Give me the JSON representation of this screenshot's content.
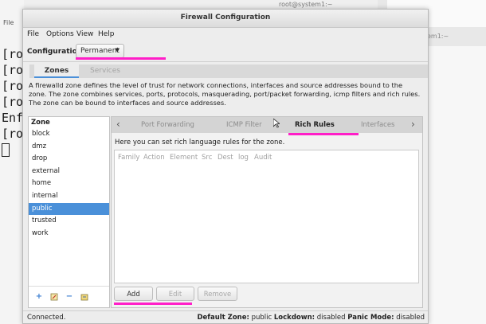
{
  "background": {
    "terminal_menu": "File",
    "terminal_lines": [
      "[ro",
      "[ro",
      "[ro",
      "[ro",
      "Enf",
      "[ro"
    ],
    "title_fragment": "root@system1:~",
    "right_tab_fragment": "em1:~"
  },
  "window": {
    "title": "Firewall Configuration",
    "menu": [
      "File",
      "Options",
      "View",
      "Help"
    ],
    "config_label": "Configuration:",
    "config_value": "Permanent",
    "main_tabs": [
      "Zones",
      "Services"
    ],
    "description": "A firewalld zone defines the level of trust for network connections, interfaces and source addresses bound to the zone. The zone combines services, ports, protocols, masquerading, port/packet forwarding, icmp filters and rich rules. The zone can be bound to interfaces and source addresses."
  },
  "zones": {
    "header": "Zone",
    "items": [
      "block",
      "dmz",
      "drop",
      "external",
      "home",
      "internal",
      "public",
      "trusted",
      "work"
    ],
    "selected": "public",
    "tool_icons": [
      "add-icon",
      "edit-icon",
      "remove-icon",
      "load-defaults-icon"
    ]
  },
  "subtabs": {
    "items": [
      "Port Forwarding",
      "ICMP Filter",
      "Rich Rules",
      "Interfaces"
    ],
    "active": "Rich Rules"
  },
  "rich_rules": {
    "hint": "Here you can set rich language rules for the zone.",
    "columns": [
      "Family",
      "Action",
      "Element",
      "Src",
      "Dest",
      "log",
      "Audit"
    ],
    "buttons": {
      "add": "Add",
      "edit": "Edit",
      "remove": "Remove"
    }
  },
  "statusbar": {
    "left": "Connected.",
    "default_zone_label": "Default Zone:",
    "default_zone": "public",
    "lockdown_label": "Lockdown:",
    "lockdown": "disabled",
    "panic_label": "Panic Mode:",
    "panic": "disabled"
  },
  "colors": {
    "accent": "#4a90d9",
    "annotation": "#ff1ec8"
  }
}
